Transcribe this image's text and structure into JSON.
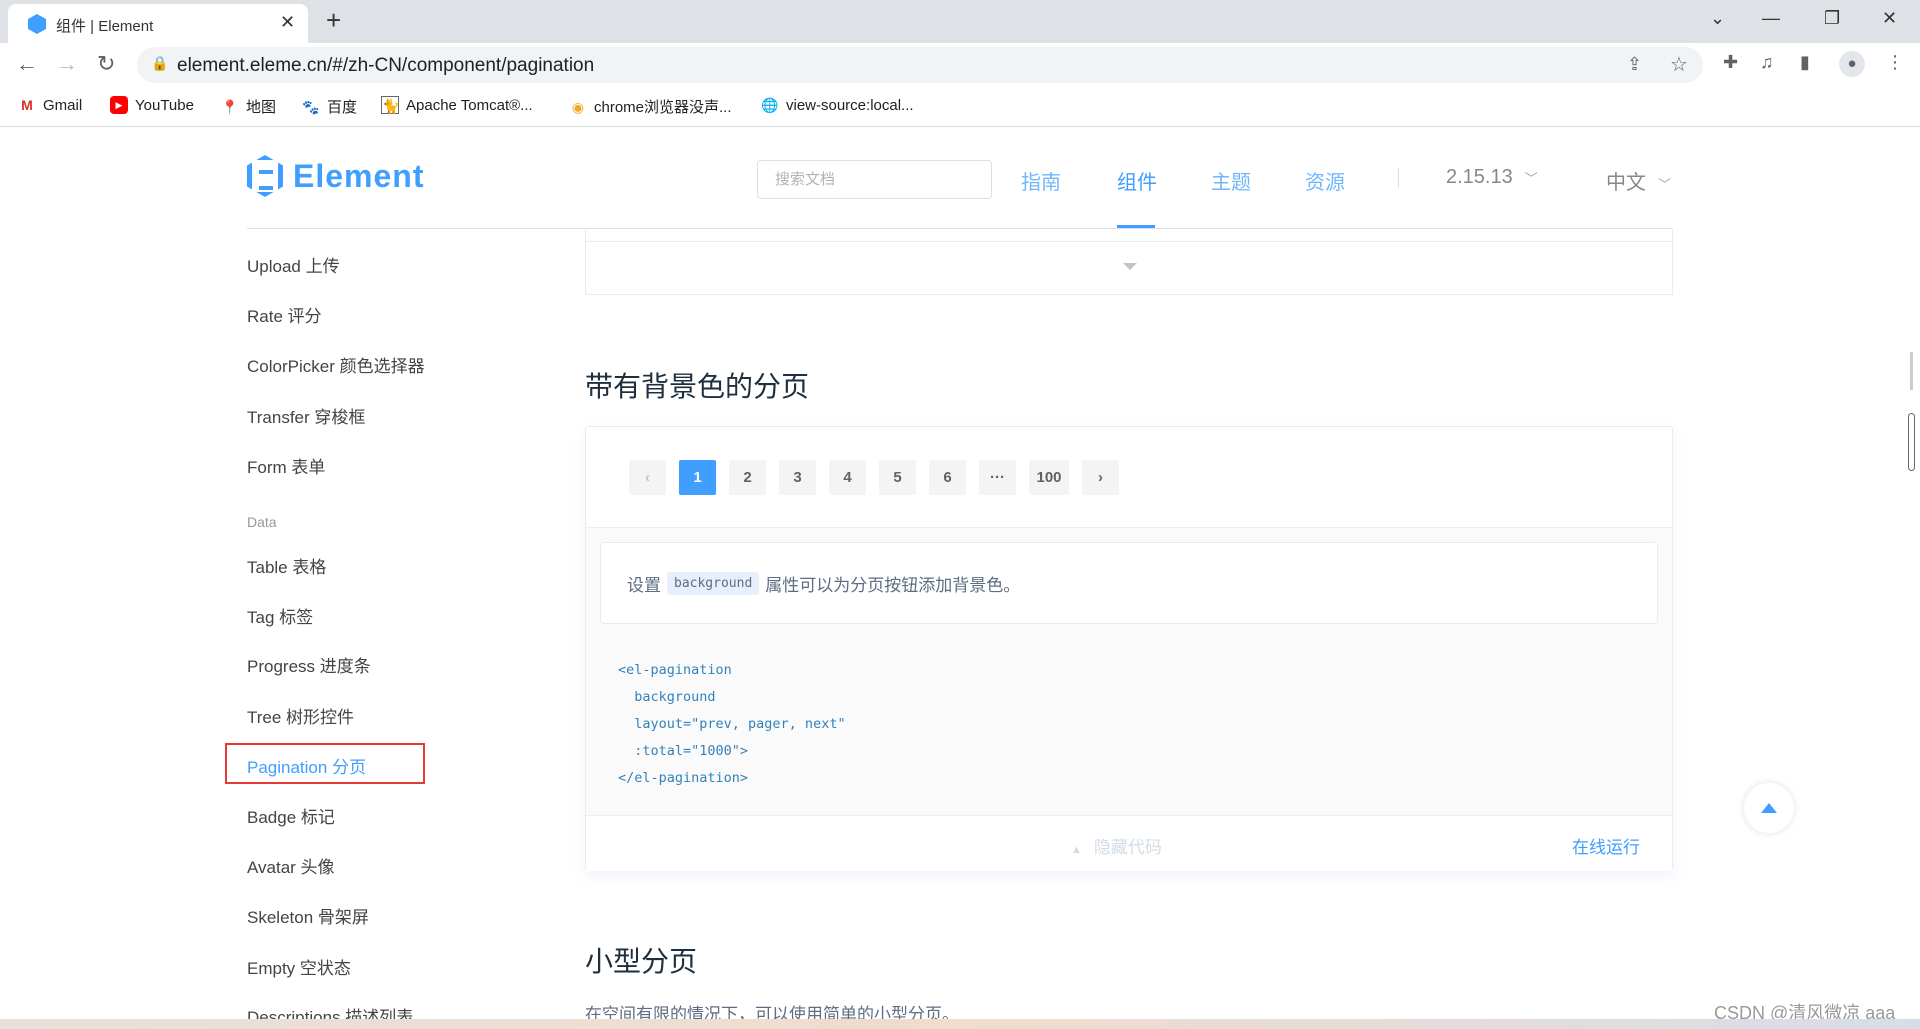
{
  "browser": {
    "tab_title": "组件 | Element",
    "url": "element.eleme.cn/#/zh-CN/component/pagination",
    "bookmarks": [
      "Gmail",
      "YouTube",
      "地图",
      "百度",
      "Apache Tomcat®...",
      "chrome浏览器没声...",
      "view-source:local..."
    ]
  },
  "header": {
    "logo": "Element",
    "search_placeholder": "搜索文档",
    "nav": [
      "指南",
      "组件",
      "主题",
      "资源"
    ],
    "version": "2.15.13",
    "language": "中文"
  },
  "sidebar": {
    "items": [
      "Upload 上传",
      "Rate 评分",
      "ColorPicker 颜色选择器",
      "Transfer 穿梭框",
      "Form 表单",
      "Data",
      "Table 表格",
      "Tag 标签",
      "Progress 进度条",
      "Tree 树形控件",
      "Pagination 分页",
      "Badge 标记",
      "Avatar 头像",
      "Skeleton 骨架屏",
      "Empty 空状态",
      "Descriptions 描述列表"
    ],
    "active": "Pagination 分页"
  },
  "section": {
    "title": "带有背景色的分页",
    "pager": {
      "prev": "‹",
      "pages": [
        "1",
        "2",
        "3",
        "4",
        "5",
        "6",
        "···",
        "100"
      ],
      "next": "›",
      "current": "1"
    },
    "desc_before": "设置",
    "desc_code": "background",
    "desc_after": "属性可以为分页按钮添加背景色。",
    "code": [
      "<el-pagination",
      "  background",
      "  layout=\"prev, pager, next\"",
      "  :total=\"1000\">",
      "</el-pagination>"
    ],
    "hide_code": "隐藏代码",
    "run_online": "在线运行"
  },
  "next_section": {
    "title": "小型分页",
    "text": "在空间有限的情况下，可以使用简单的小型分页。"
  },
  "watermark": "CSDN @清风微凉 aaa",
  "colors": {
    "primary": "#409eff",
    "highlight_box": "#e53935"
  }
}
